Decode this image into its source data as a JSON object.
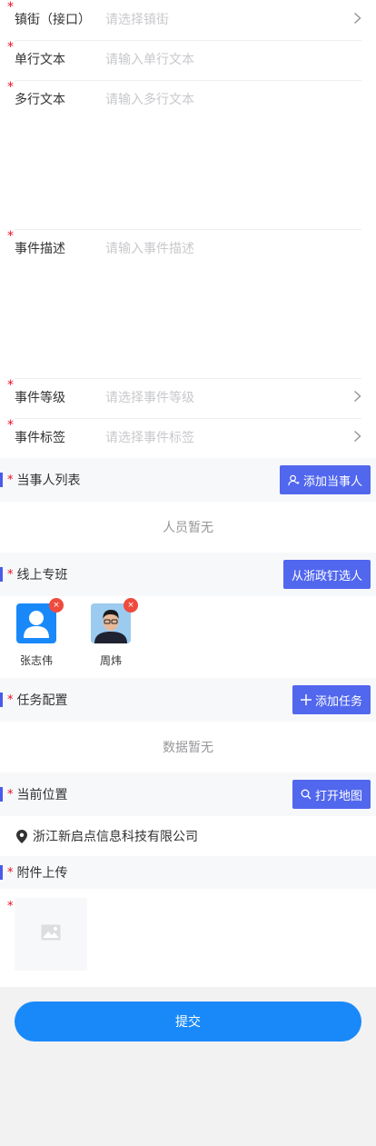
{
  "form": {
    "street": {
      "label": "镇街（接口）",
      "placeholder": "请选择镇街"
    },
    "single_text": {
      "label": "单行文本",
      "placeholder": "请输入单行文本"
    },
    "multi_text": {
      "label": "多行文本",
      "placeholder": "请输入多行文本"
    },
    "event_desc": {
      "label": "事件描述",
      "placeholder": "请输入事件描述"
    },
    "event_level": {
      "label": "事件等级",
      "placeholder": "请选择事件等级"
    },
    "event_tags": {
      "label": "事件标签",
      "placeholder": "请选择事件标签"
    },
    "required_mark": "*"
  },
  "parties": {
    "title": "当事人列表",
    "button": "添加当事人",
    "empty": "人员暂无"
  },
  "team": {
    "title": "线上专班",
    "button": "从浙政钉选人",
    "members": [
      {
        "name": "张志伟",
        "avatar": "default-avatar-icon"
      },
      {
        "name": "周炜",
        "avatar": "photo-avatar"
      }
    ],
    "remove_glyph": "×"
  },
  "tasks": {
    "title": "任务配置",
    "button": "添加任务",
    "empty": "数据暂无"
  },
  "location": {
    "title": "当前位置",
    "button": "打开地图",
    "address": "浙江新启点信息科技有限公司"
  },
  "attachments": {
    "title": "附件上传"
  },
  "submit": {
    "label": "提交"
  },
  "colors": {
    "accent": "#5167ee",
    "submit": "#1989fa",
    "required": "#ee0a24"
  }
}
